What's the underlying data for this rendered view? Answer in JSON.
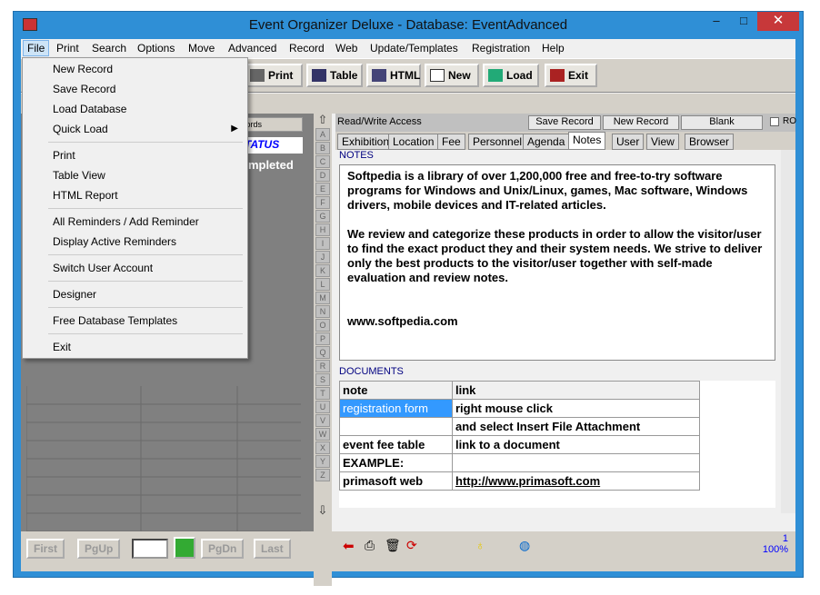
{
  "window": {
    "title": "Event Organizer Deluxe - Database: EventAdvanced",
    "minimize": "–",
    "maximize": "□",
    "close": "✕"
  },
  "menubar": [
    "File",
    "Print",
    "Search",
    "Options",
    "Move",
    "Advanced",
    "Record",
    "Web",
    "Update/Templates",
    "Registration",
    "Help"
  ],
  "toolbar": {
    "print": "Print",
    "table": "Table",
    "html": "HTML",
    "new": "New",
    "load": "Load",
    "exit": "Exit"
  },
  "file_menu": {
    "new_record": "New Record",
    "save_record": "Save Record",
    "load_database": "Load Database",
    "quick_load": "Quick Load",
    "print": "Print",
    "table_view": "Table View",
    "html_report": "HTML Report",
    "all_reminders": "All Reminders / Add Reminder",
    "display_reminders": "Display Active Reminders",
    "switch_user": "Switch User Account",
    "designer": "Designer",
    "free_templates": "Free Database Templates",
    "exit": "Exit"
  },
  "left": {
    "records_label": "cords",
    "status_header": "TATUS",
    "completed": "ompleted"
  },
  "alpha": [
    "A",
    "B",
    "C",
    "D",
    "E",
    "F",
    "G",
    "H",
    "I",
    "J",
    "K",
    "L",
    "M",
    "N",
    "O",
    "P",
    "Q",
    "R",
    "S",
    "T",
    "U",
    "V",
    "W",
    "X",
    "Y",
    "Z"
  ],
  "record_bar": {
    "access": "Read/Write Access",
    "save": "Save Record",
    "new": "New Record",
    "blank": "Blank",
    "ro": "RO"
  },
  "tabs": [
    "Exhibition",
    "Location",
    "Fee",
    "Personnel",
    "Agenda",
    "Notes",
    "User",
    "View",
    "Browser"
  ],
  "notes": {
    "header": "NOTES",
    "p1": "Softpedia is a library of over 1,200,000 free and free-to-try software programs for Windows and Unix/Linux, games, Mac software, Windows drivers, mobile devices and IT-related articles.",
    "p2": "We review and categorize these products in order to allow the visitor/user to find the exact product they and their system needs. We strive to deliver only the best products to the visitor/user together with self-made evaluation and review notes.",
    "p3": "www.softpedia.com"
  },
  "documents": {
    "header": "DOCUMENTS",
    "col_note": "note",
    "col_link": "link",
    "rows": [
      [
        "registration form",
        "right mouse click"
      ],
      [
        "",
        "and select Insert File Attachment"
      ],
      [
        "event fee table",
        "link to a document"
      ],
      [
        "EXAMPLE:",
        ""
      ],
      [
        "primasoft web",
        "http://www.primasoft.com"
      ]
    ]
  },
  "nav": {
    "first": "First",
    "pgup": "PgUp",
    "pgdn": "PgDn",
    "last": "Last"
  },
  "status": {
    "record_no": "1",
    "zoom": "100%"
  }
}
